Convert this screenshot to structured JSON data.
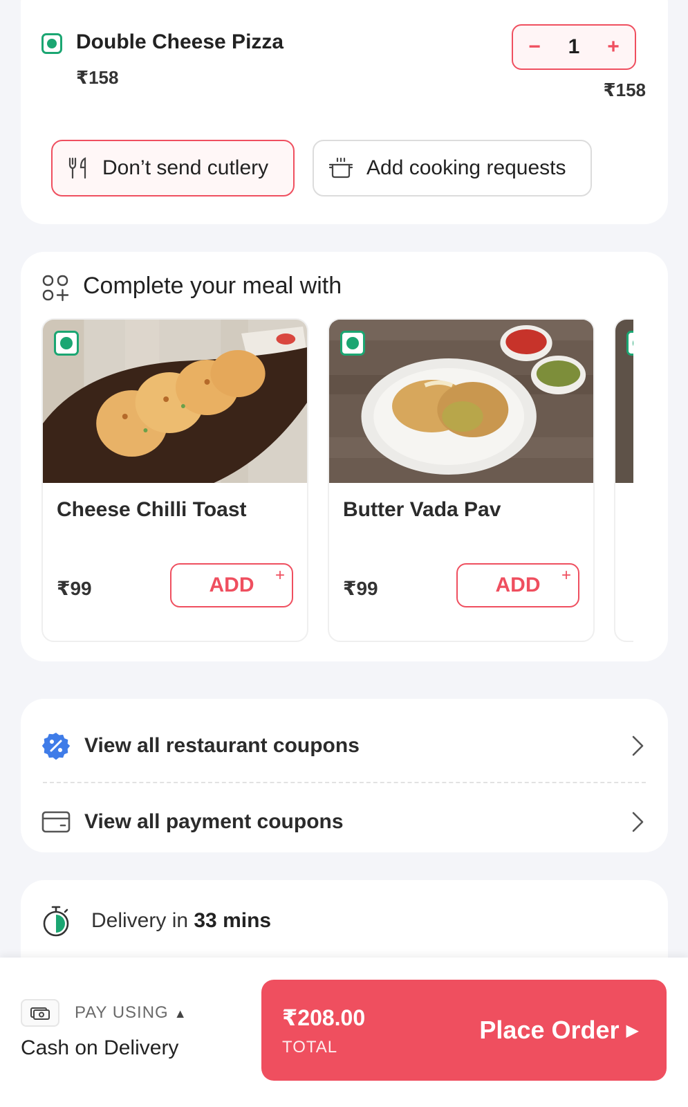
{
  "cart_item": {
    "name": "Double Cheese Pizza",
    "unit_price": "₹158",
    "quantity": "1",
    "line_total": "₹158",
    "decrement_symbol": "−",
    "increment_symbol": "+",
    "veg": true
  },
  "actions": {
    "cutlery_label": "Don’t send cutlery",
    "cooking_label": "Add cooking requests"
  },
  "meal_section": {
    "title": "Complete your meal with",
    "items": [
      {
        "name": "Cheese Chilli Toast",
        "price": "₹99",
        "add_label": "ADD",
        "add_plus": "+"
      },
      {
        "name": "Butter Vada Pav",
        "price": "₹99",
        "add_label": "ADD",
        "add_plus": "+"
      }
    ]
  },
  "coupons": {
    "restaurant_label": "View all restaurant coupons",
    "payment_label": "View all payment coupons"
  },
  "delivery": {
    "prefix": "Delivery in ",
    "time": "33 mins"
  },
  "bottom_bar": {
    "pay_using_label": "PAY USING",
    "pay_method": "Cash on Delivery",
    "total_amount": "₹208.00",
    "total_label": "TOTAL",
    "place_order_label": "Place Order"
  },
  "colors": {
    "accent": "#ef4f5f",
    "veg_green": "#1ba672",
    "coupon_blue": "#3f7ce8"
  }
}
